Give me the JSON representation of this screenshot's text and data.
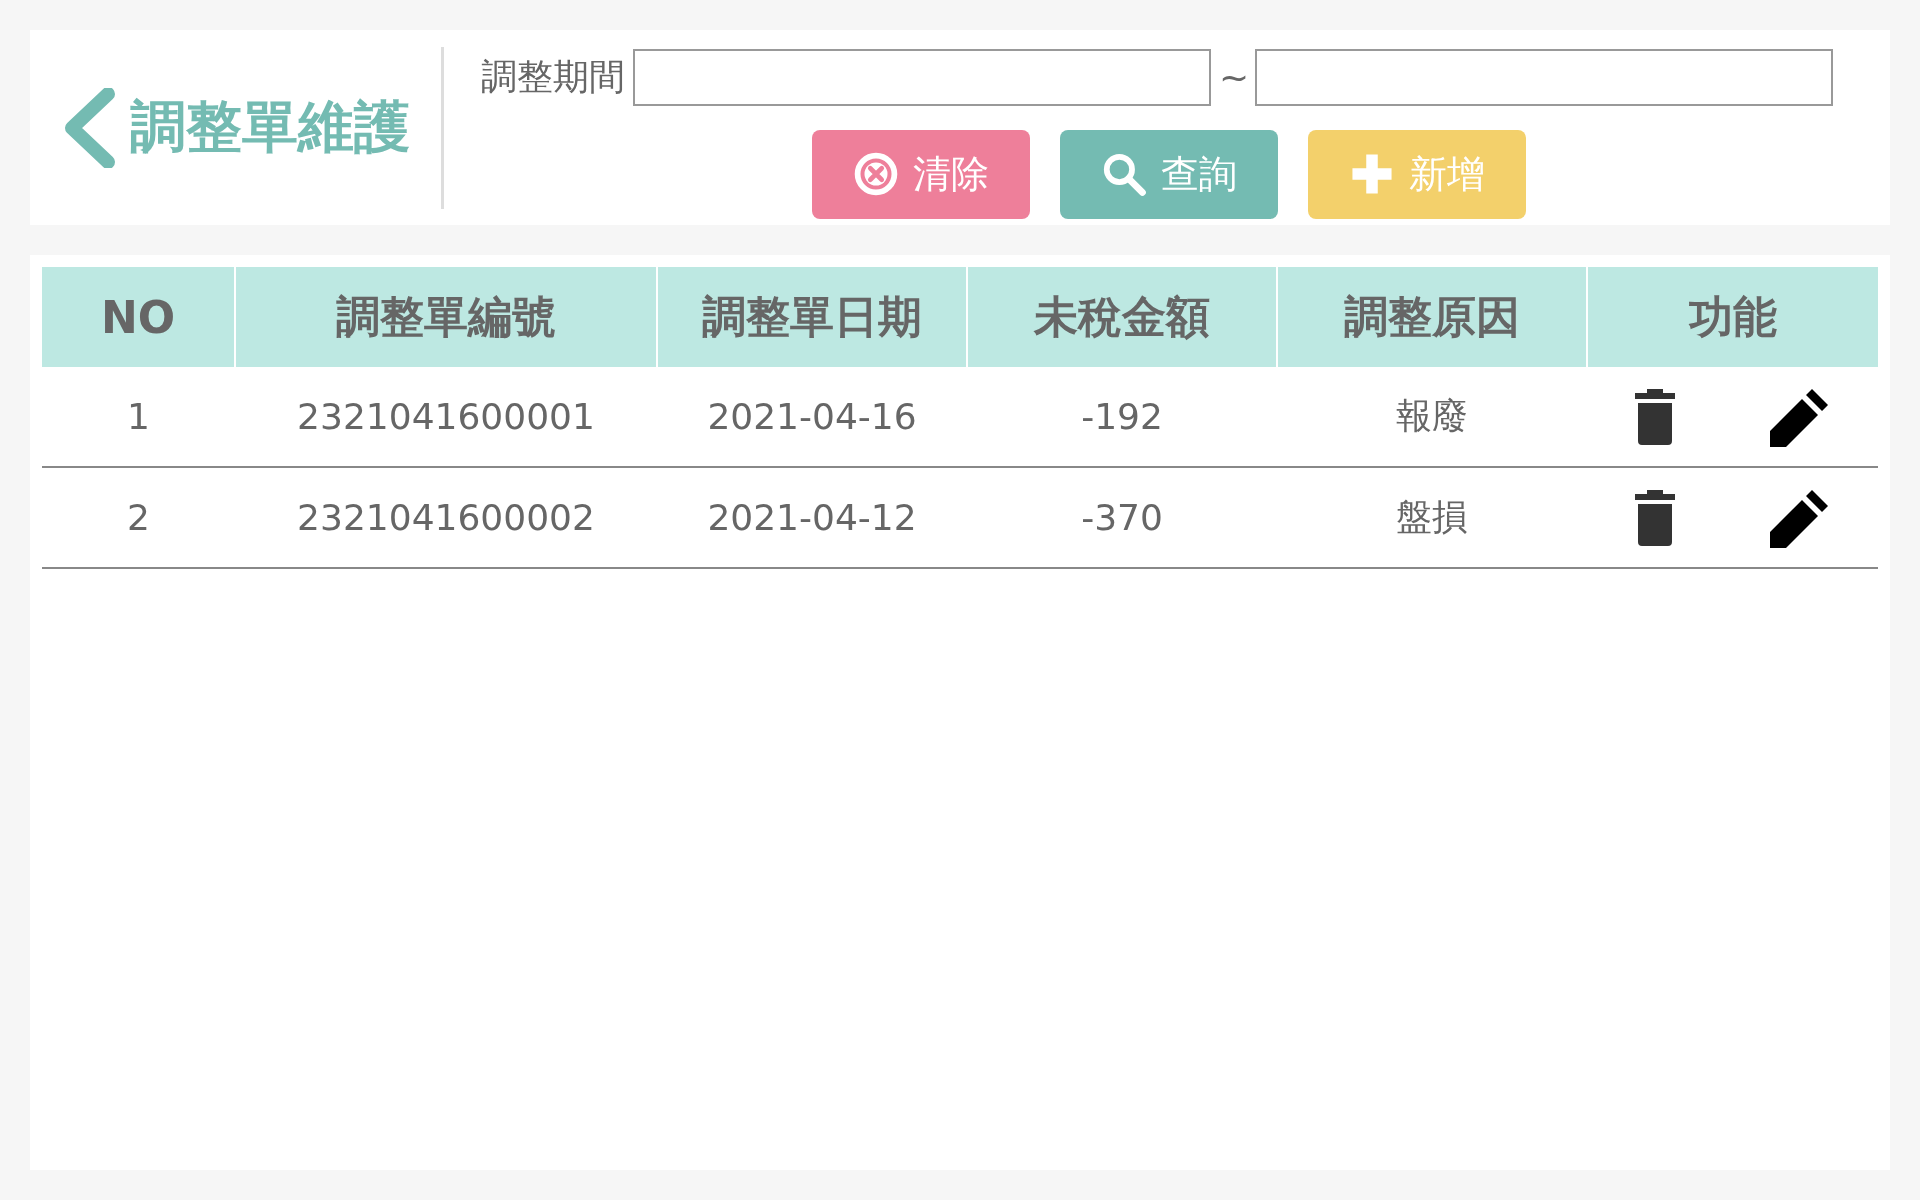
{
  "header": {
    "title": "調整單維護",
    "period_label": "調整期間",
    "period_separator": "~",
    "buttons": [
      {
        "kind": "clear",
        "label": "清除"
      },
      {
        "kind": "search",
        "label": "查詢"
      },
      {
        "kind": "add",
        "label": "新增"
      }
    ]
  },
  "table": {
    "columns": [
      "NO",
      "調整單編號",
      "調整單日期",
      "未稅金額",
      "調整原因",
      "功能"
    ],
    "rows": [
      {
        "no": "1",
        "number": "2321041600001",
        "date": "2021-04-16",
        "amount": "-192",
        "reason": "報廢"
      },
      {
        "no": "2",
        "number": "2321041600002",
        "date": "2021-04-12",
        "amount": "-370",
        "reason": "盤損"
      }
    ]
  }
}
